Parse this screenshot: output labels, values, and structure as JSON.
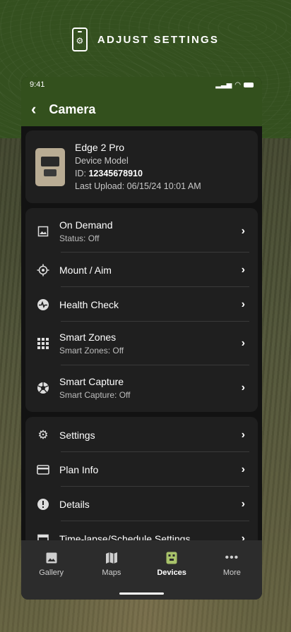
{
  "banner": {
    "title": "ADJUST SETTINGS",
    "icon": "phone-settings-icon"
  },
  "status_bar": {
    "time": "9:41"
  },
  "app_bar": {
    "title": "Camera"
  },
  "device": {
    "name": "Edge 2 Pro",
    "model": "Device Model",
    "id_label": "ID:",
    "id_value": "12345678910",
    "last_upload": "Last Upload: 06/15/24 10:01 AM"
  },
  "camera_menu": [
    {
      "icon": "image-icon",
      "title": "On Demand",
      "subtitle": "Status: Off"
    },
    {
      "icon": "crosshair-icon",
      "title": "Mount / Aim"
    },
    {
      "icon": "health-icon",
      "title": "Health Check"
    },
    {
      "icon": "grid-icon",
      "title": "Smart Zones",
      "subtitle": "Smart Zones: Off"
    },
    {
      "icon": "aperture-icon",
      "title": "Smart Capture",
      "subtitle": "Smart Capture: Off"
    }
  ],
  "settings_menu": [
    {
      "icon": "gear-icon",
      "title": "Settings"
    },
    {
      "icon": "credit-card-icon",
      "title": "Plan Info"
    },
    {
      "icon": "info-icon",
      "title": "Details"
    },
    {
      "icon": "calendar-icon",
      "title": "Time-lapse/Schedule Settings"
    }
  ],
  "bottom_nav": [
    {
      "icon": "gallery-icon",
      "label": "Gallery"
    },
    {
      "icon": "map-icon",
      "label": "Maps"
    },
    {
      "icon": "camera-device-icon",
      "label": "Devices",
      "active": true
    },
    {
      "icon": "more-icon",
      "label": "More"
    }
  ],
  "colors": {
    "brand_green": "#33501d",
    "card": "#1f1f1f",
    "accent_device": "#a8c26a"
  }
}
